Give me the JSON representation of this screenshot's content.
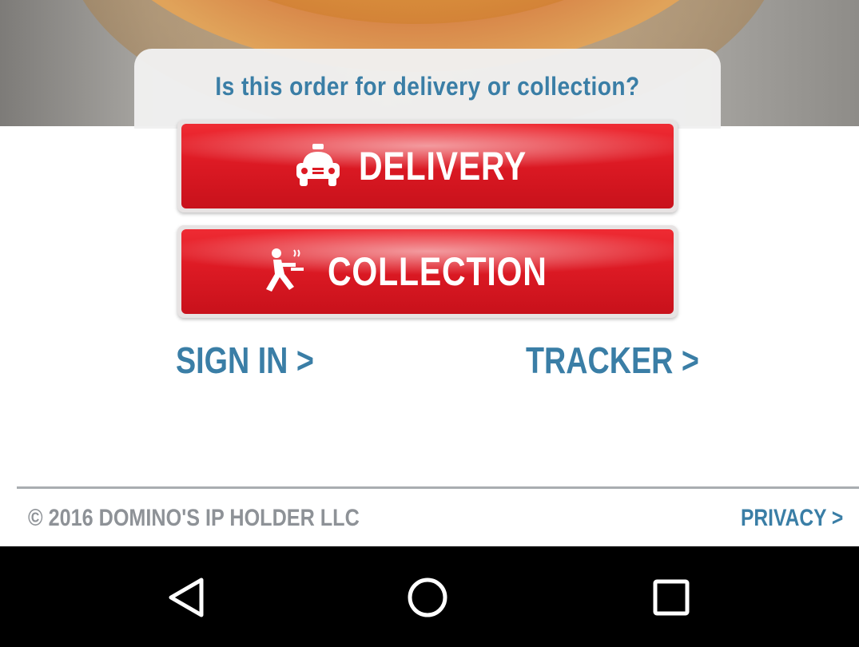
{
  "header": {
    "question": "Is this order for delivery or collection?"
  },
  "buttons": {
    "delivery_label": "DELIVERY",
    "delivery_icon": "delivery-car-icon",
    "collection_label": "COLLECTION",
    "collection_icon": "carryout-person-icon"
  },
  "links": {
    "sign_in": "SIGN IN >",
    "tracker": "TRACKER >",
    "privacy": "PRIVACY >"
  },
  "footer": {
    "copyright": "© 2016 DOMINO'S IP HOLDER LLC"
  },
  "navbar": {
    "back_icon": "back-triangle-icon",
    "home_icon": "home-circle-icon",
    "recent_icon": "recent-apps-square-icon"
  },
  "colors": {
    "accent_blue": "#3a7ea6",
    "button_red": "#dd1a24",
    "footer_gray": "#8e9297",
    "navbar_bg": "#000000"
  }
}
